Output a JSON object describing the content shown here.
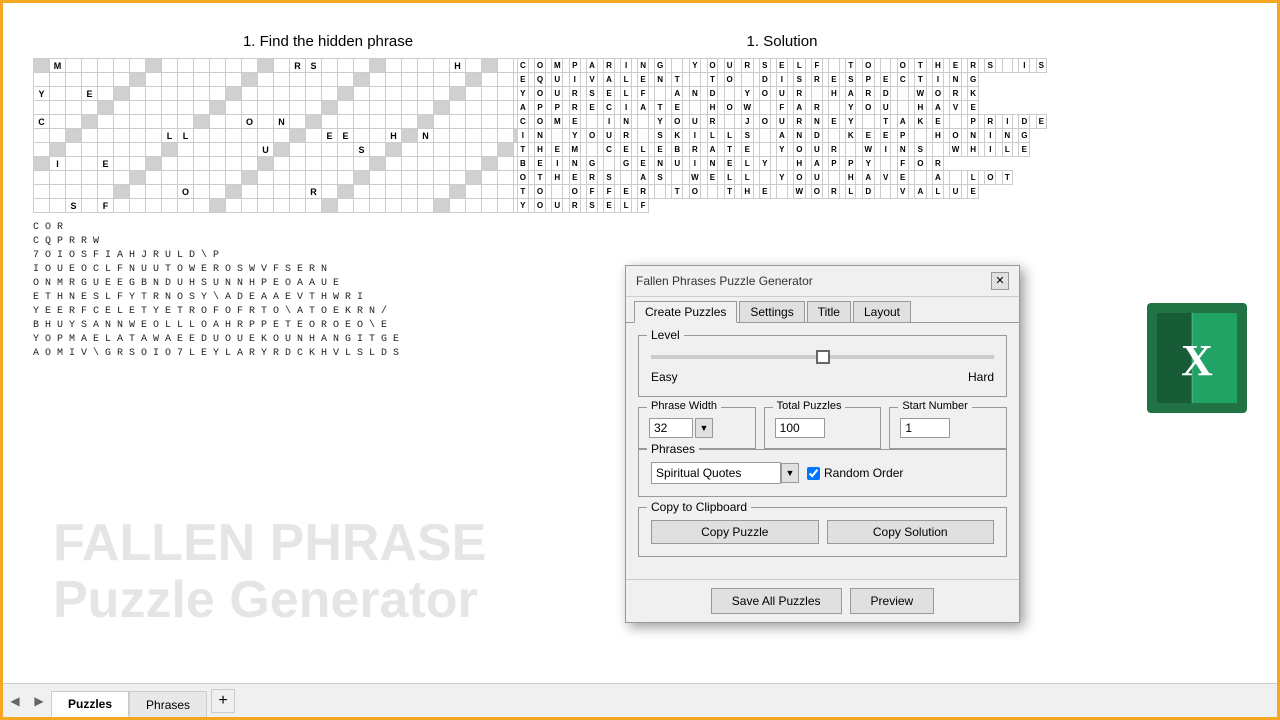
{
  "puzzle": {
    "title": "1. Find the hidden phrase",
    "watermark_line1": "FALLEN PHRASE",
    "watermark_line2": "Puzzle Generator"
  },
  "solution": {
    "title": "1. Solution",
    "text": [
      "C O M P A R I N G   Y O U R S E L F   T O   O T H E R S   I S",
      "E Q U I V A L E N T   T O   D I S R E S P E C T I N G",
      "Y O U R S E L F   A N D   Y O U R   H A R D   W O R K",
      "A P P R E C I A T E   H O W   F A R   Y O U   H A V E",
      "C O M E   I N   Y O U R   J O U R N E Y   T A K E   P R I D E",
      "I N   Y O U R   S K I L L S   A N D   K E E P   H O N I N G",
      "T H E M   C E L E B R A T E   Y O U R   W I N S   W H I L E",
      "B E I N G   G E N U I N E L Y   H A P P Y   F O R",
      "O T H E R S   A S   W E L L   Y O U   H A V E   A   L O T",
      "T O   O F F E R   T O   T H E   W O R L D   V A L U E",
      "Y O U R S E L F"
    ]
  },
  "dialog": {
    "title": "Fallen Phrases Puzzle Generator",
    "tabs": [
      "Create Puzzles",
      "Settings",
      "Title",
      "Layout"
    ],
    "active_tab": "Create Puzzles",
    "level_group": "Level",
    "level_easy": "Easy",
    "level_hard": "Hard",
    "level_value": 50,
    "phrase_width_label": "Phrase Width",
    "phrase_width_value": "32",
    "total_puzzles_label": "Total Puzzles",
    "total_puzzles_value": "100",
    "start_number_label": "Start Number",
    "start_number_value": "1",
    "phrases_label": "Phrases",
    "phrases_dropdown": "Spiritual Quotes",
    "random_order_label": "Random Order",
    "copy_clipboard_label": "Copy to Clipboard",
    "copy_puzzle_label": "Copy Puzzle",
    "copy_solution_label": "Copy Solution",
    "save_all_label": "Save All Puzzles",
    "preview_label": "Preview"
  },
  "fallen_letters": [
    "C O   R",
    "C Q   P  R R                  W",
    "7 O  I O S F I A      H  J     R U   L D     \\   P",
    "I O U E O C L F N U U T O W   E R O   S W V F S E R N",
    "O N M R G U E E G B N D U H S U N N H P E O A A U E",
    "E T H N E S L F Y T R N O S Y \\ A D E A A E V T H W R I",
    "Y E E R F C E L E T Y E T R O F O F R T O \\ A T O E K R N /",
    "B H U Y S A N N W E O L L L O A H R P P E T E O R O E O \\ E",
    "Y O P M A E L A T A W A E E D U O U E K O U N H A N G I T G E",
    "A O M I V \\ G R S O I O 7 L E Y L A R Y R D C K H V L S L D S"
  ],
  "taskbar": {
    "sheets": [
      "Puzzles",
      "Phrases"
    ],
    "active_sheet": "Puzzles",
    "add_label": "+"
  }
}
